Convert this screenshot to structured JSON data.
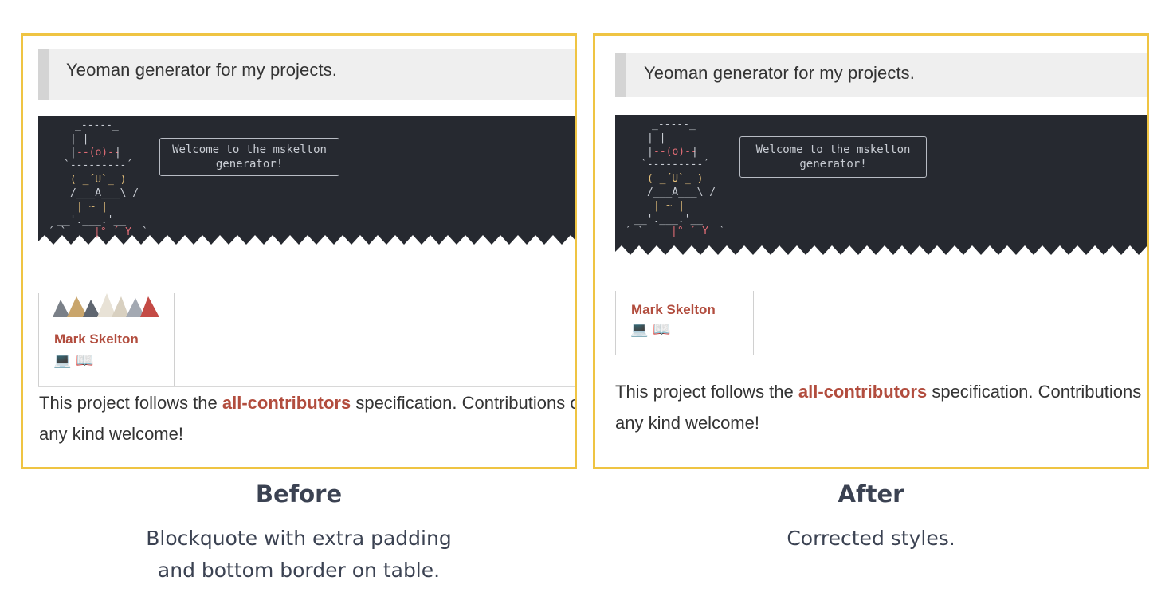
{
  "before": {
    "blockquote_text": "Yeoman generator for my projects.",
    "welcome_text": "Welcome to the mskelton\ngenerator!",
    "contributor_name": "Mark Skelton",
    "contributor_icons": "💻 📖",
    "para_prefix": "This project follows the ",
    "para_link": "all-contributors",
    "para_suffix": " specification. Contributions of",
    "para_line2": "any kind welcome!",
    "caption_title": "Before",
    "caption_line1": "Blockquote with extra padding",
    "caption_line2": "and bottom border on table."
  },
  "after": {
    "blockquote_text": "Yeoman generator for my projects.",
    "welcome_text": "Welcome to the mskelton\ngenerator!",
    "contributor_name": "Mark Skelton",
    "contributor_icons": "💻 📖",
    "para_prefix": "This project follows the ",
    "para_link": "all-contributors",
    "para_suffix": " specification. Contributions of",
    "para_line2": "any kind welcome!",
    "caption_title": "After",
    "caption_line1": "Corrected styles."
  },
  "colors": {
    "frame": "#efc443",
    "terminal_bg": "#262930",
    "link": "#b24d3e",
    "caption": "#3b4252"
  }
}
